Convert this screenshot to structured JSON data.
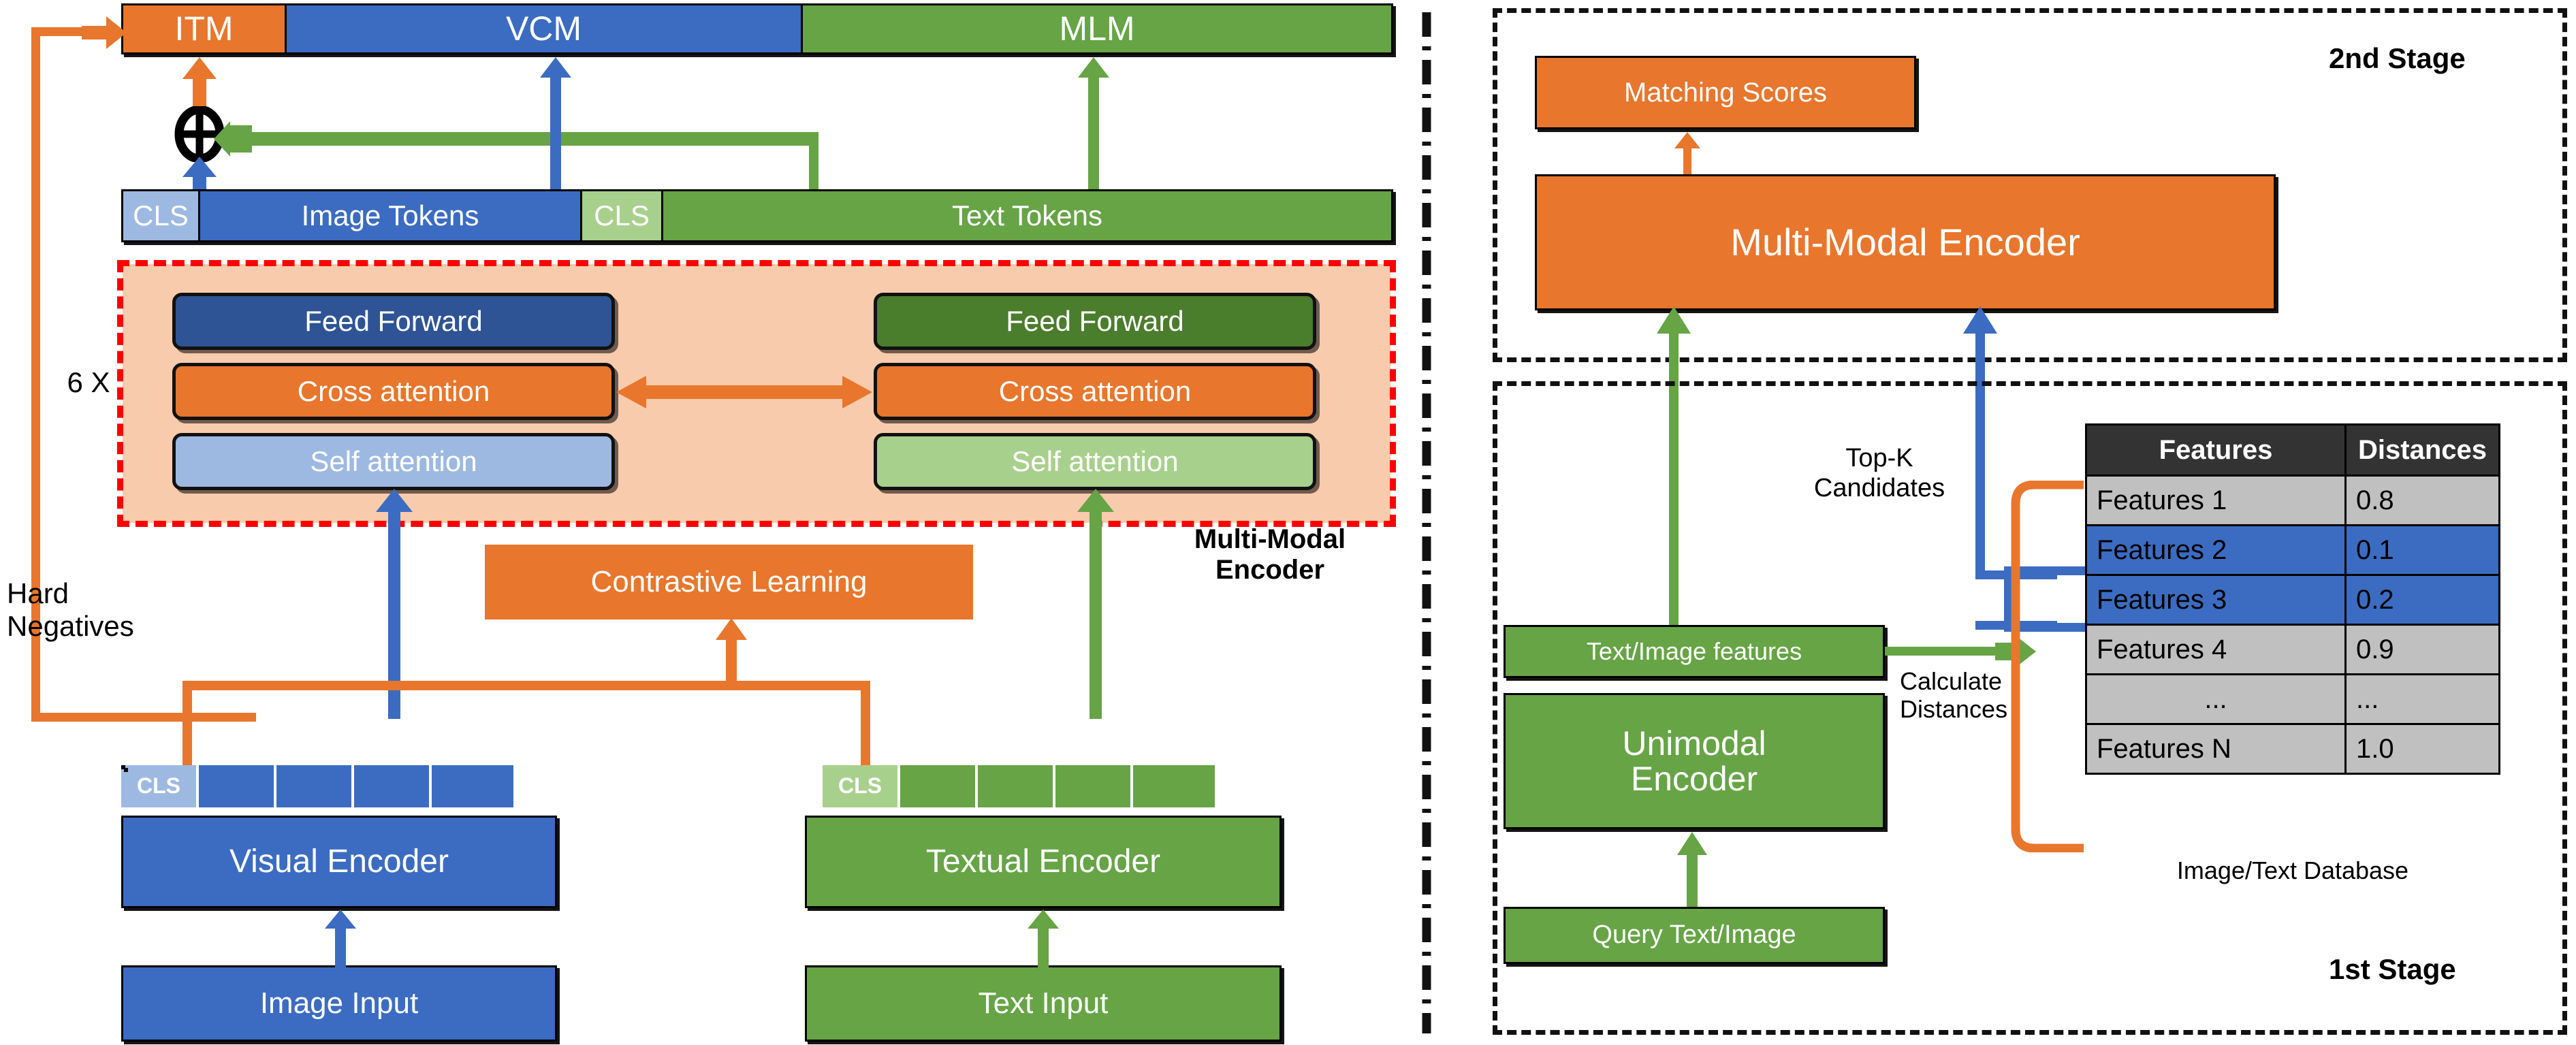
{
  "left_panel": {
    "objectives": [
      {
        "label": "ITM",
        "color": "#E8762C"
      },
      {
        "label": "VCM",
        "color": "#3B6CC1"
      },
      {
        "label": "MLM",
        "color": "#66A445"
      }
    ],
    "token_row": [
      {
        "label": "CLS",
        "color": "#9DB9E2"
      },
      {
        "label": "Image Tokens",
        "color": "#3B6CC1"
      },
      {
        "label": "CLS",
        "color": "#A8D08D"
      },
      {
        "label": "Text Tokens",
        "color": "#66A445"
      }
    ],
    "repeat_label": "6 X",
    "hard_negatives_label": "Hard\nNegatives",
    "multimodal_encoder_label": "Multi-Modal\nEncoder",
    "image_branch_layers": [
      {
        "label": "Feed Forward",
        "color": "#2E5496"
      },
      {
        "label": "Cross attention",
        "color": "#E8762C"
      },
      {
        "label": "Self attention",
        "color": "#9DB9E2"
      }
    ],
    "text_branch_layers": [
      {
        "label": "Feed Forward",
        "color": "#4A7D2C"
      },
      {
        "label": "Cross attention",
        "color": "#E8762C"
      },
      {
        "label": "Self attention",
        "color": "#A8D08D"
      }
    ],
    "contrastive_label": "Contrastive Learning",
    "visual_cls": "CLS",
    "text_cls": "CLS",
    "visual_encoder_label": "Visual Encoder",
    "textual_encoder_label": "Textual Encoder",
    "image_input_label": "Image Input",
    "text_input_label": "Text Input"
  },
  "right_panel": {
    "stage2_label": "2nd Stage",
    "stage1_label": "1st Stage",
    "matching_scores_label": "Matching Scores",
    "multimodal_encoder_label": "Multi-Modal Encoder",
    "text_image_features_label": "Text/Image features",
    "unimodal_encoder_label": "Unimodal\nEncoder",
    "query_label": "Query Text/Image",
    "topk_label": "Top-K\nCandidates",
    "calc_distances_label": "Calculate\nDistances",
    "database_caption": "Image/Text Database",
    "table": {
      "headers": [
        "Features",
        "Distances"
      ],
      "rows": [
        {
          "feature": "Features 1",
          "distance": "0.8",
          "highlight": false
        },
        {
          "feature": "Features 2",
          "distance": "0.1",
          "highlight": true
        },
        {
          "feature": "Features 3",
          "distance": "0.2",
          "highlight": true
        },
        {
          "feature": "Features 4",
          "distance": "0.9",
          "highlight": false
        },
        {
          "feature": "...",
          "distance": "...",
          "highlight": false
        },
        {
          "feature": "Features N",
          "distance": "1.0",
          "highlight": false
        }
      ]
    }
  },
  "colors": {
    "orange": "#E8762C",
    "blue": "#3B6CC1",
    "green": "#66A445",
    "dark_blue": "#2E5496",
    "dark_green": "#4A7D2C",
    "light_blue": "#9DB9E2",
    "light_green": "#A8D08D",
    "peach": "#F8CBAD",
    "red_dash": "#FF0000",
    "table_header": "#333333",
    "table_row": "#C0C0C0",
    "table_highlight": "#3B6CC1"
  }
}
